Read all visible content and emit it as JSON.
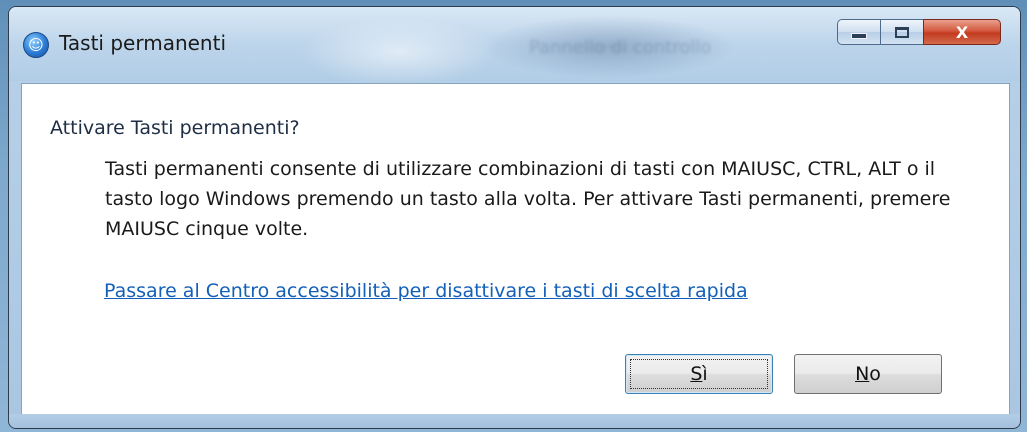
{
  "window": {
    "title": "Tasti permanenti",
    "background_ghost_text": "Pannello di controllo",
    "icon": "accessibility-icon",
    "controls": {
      "minimize_icon": "minimize-icon",
      "maximize_icon": "maximize-icon",
      "close_label": "X"
    }
  },
  "dialog": {
    "question": "Attivare Tasti permanenti?",
    "description": "Tasti permanenti consente di utilizzare combinazioni di tasti con MAIUSC, CTRL, ALT o il tasto logo Windows premendo un tasto alla volta. Per attivare Tasti permanenti, premere MAIUSC cinque volte.",
    "link": "Passare al Centro accessibilità per disattivare i tasti di scelta rapida",
    "buttons": {
      "yes_accel": "S",
      "yes_rest": "ì",
      "no_accel": "N",
      "no_rest": "o"
    }
  },
  "colors": {
    "link": "#1460b8",
    "close_button": "#c23a1f"
  }
}
